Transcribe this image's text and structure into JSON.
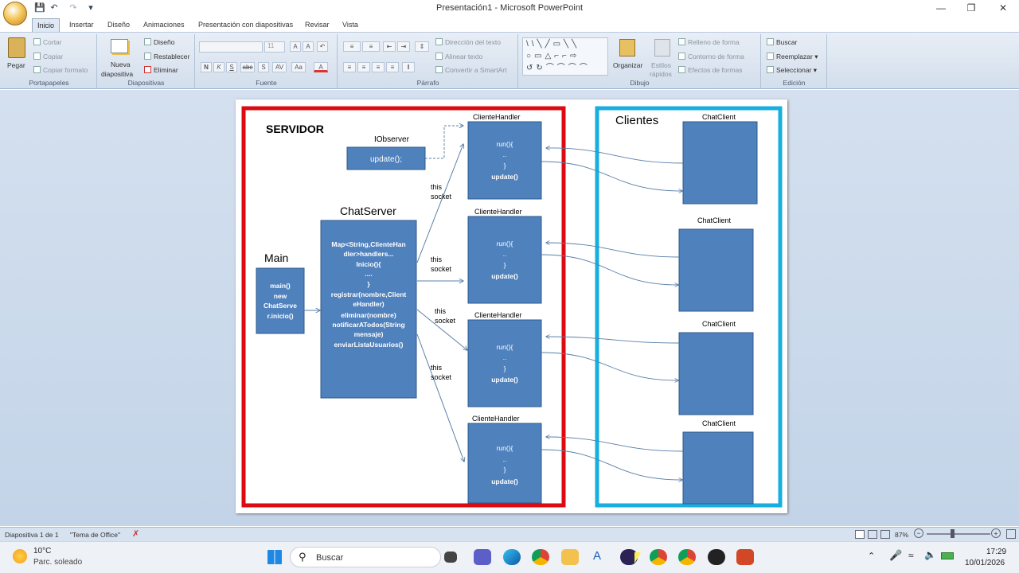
{
  "app": {
    "window_title": "Presentación1 - Microsoft PowerPoint"
  },
  "tabs": [
    "Inicio",
    "Insertar",
    "Diseño",
    "Animaciones",
    "Presentación con diapositivas",
    "Revisar",
    "Vista"
  ],
  "ribbon": {
    "portapapeles": {
      "label": "Portapapeles",
      "pegar": "Pegar",
      "cortar": "Cortar",
      "copiar": "Copiar",
      "copiar_formato": "Copiar formato"
    },
    "diapositivas": {
      "label": "Diapositivas",
      "nueva_1": "Nueva",
      "nueva_2": "diapositiva",
      "diseno": "Diseño",
      "restablecer": "Restablecer",
      "eliminar": "Eliminar"
    },
    "fuente": {
      "label": "Fuente",
      "size": "11"
    },
    "parrafo": {
      "label": "Párrafo",
      "direccion": "Dirección del texto",
      "alinear": "Alinear texto",
      "smartart": "Convertir a SmartArt"
    },
    "dibujo": {
      "label": "Dibujo",
      "organizar": "Organizar",
      "estilos_1": "Estilos",
      "estilos_2": "rápidos",
      "relleno": "Relleno de forma",
      "contorno": "Contorno de forma",
      "efectos": "Efectos de formas"
    },
    "edicion": {
      "label": "Edición",
      "buscar": "Buscar",
      "reemplazar": "Reemplazar",
      "seleccionar": "Seleccionar"
    }
  },
  "slide": {
    "servidor": "SERVIDOR",
    "clientes": "Clientes",
    "iobserver": "IObserver",
    "update_call": "update();",
    "chatserver_title": "ChatServer",
    "chatserver_lines": [
      "Map<String,ClienteHan",
      "dler>handlers...",
      "Inicio(){",
      "....",
      "}",
      "registrar(nombre,Client",
      "eHandler)",
      "eliminar(nombre)",
      "notificarATodos(String",
      "mensaje)",
      "enviarListaUsuarios()"
    ],
    "main_title": "Main",
    "main_lines": [
      "main()",
      "new",
      "ChatServe",
      "r.inicio()"
    ],
    "handler_title": "ClienteHandler",
    "handler_lines": [
      "run(){",
      "..",
      "}",
      "update()"
    ],
    "client_title": "ChatClient",
    "this": "this",
    "socket": "socket"
  },
  "status": {
    "slide": "Diapositiva 1 de 1",
    "theme": "\"Tema de Office\"",
    "zoom": "87%"
  },
  "taskbar": {
    "temp": "10°C",
    "weather": "Parc. soleado",
    "search": "Buscar",
    "time": "17:29",
    "date": "10/01/2026"
  }
}
